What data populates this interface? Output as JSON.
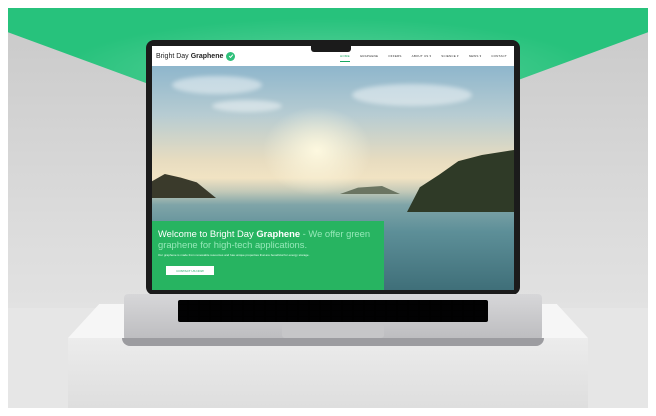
{
  "site": {
    "logo": {
      "text_light": "Bright Day",
      "text_bold": "Graphene",
      "badge_icon": "leaf-check-icon"
    },
    "nav": [
      {
        "label": "HOME",
        "active": true
      },
      {
        "label": "GRAPHENE",
        "active": false
      },
      {
        "label": "OFFERS",
        "active": false
      },
      {
        "label": "ABOUT US ▾",
        "active": false
      },
      {
        "label": "SCIENCE ▾",
        "active": false
      },
      {
        "label": "NEWS ▾",
        "active": false
      },
      {
        "label": "CONTACT",
        "active": false
      }
    ],
    "hero": {
      "title_pre": "Welcome to Bright Day ",
      "title_bold": "Graphene",
      "title_accent": " - We offer green graphene for high-tech applications.",
      "subtitle": "Our graphene is made from renewable resources and has unique properties that are beneficial for energy storage.",
      "cta_label": "CONTACT US NOW"
    }
  },
  "colors": {
    "brand_green": "#27b461",
    "backdrop_green": "#27c27c"
  }
}
